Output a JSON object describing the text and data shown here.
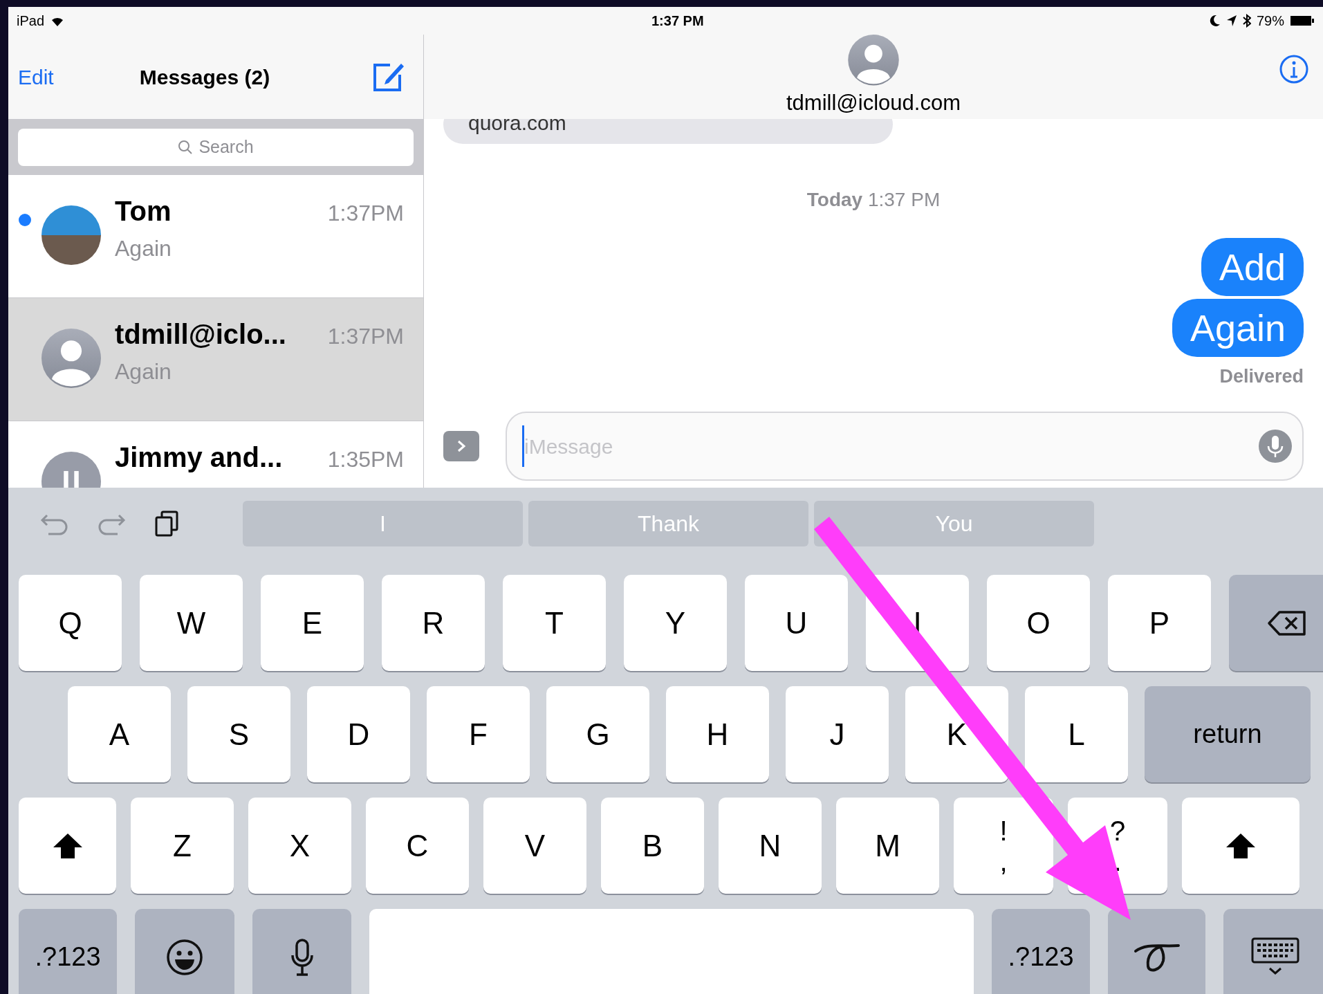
{
  "status_bar": {
    "device": "iPad",
    "time": "1:37 PM",
    "battery": "79%"
  },
  "sidebar": {
    "edit": "Edit",
    "title": "Messages (2)",
    "search": {
      "placeholder": "Search"
    },
    "conversations": [
      {
        "name": "Tom",
        "preview": "Again",
        "time": "1:37PM",
        "unread": true,
        "selected": false,
        "kind": "photo"
      },
      {
        "name": "tdmill@iclo...",
        "preview": "Again",
        "time": "1:37PM",
        "unread": false,
        "selected": true,
        "kind": "person"
      },
      {
        "name": "Jimmy and...",
        "time": "1:35PM",
        "unread": false,
        "selected": false,
        "kind": "group"
      }
    ]
  },
  "chat": {
    "contact": "tdmill@icloud.com",
    "messages": [
      {
        "kind": "received",
        "text": "quora.com"
      },
      {
        "kind": "timestamp",
        "text": "**Today** 1:37 PM"
      },
      {
        "kind": "sent",
        "text": "Add"
      },
      {
        "kind": "sent",
        "text": "Again"
      },
      {
        "kind": "status",
        "text": "Delivered"
      }
    ],
    "input": {
      "placeholder": "iMessage"
    }
  },
  "keyboard": {
    "suggestions": [
      "I",
      "Thank",
      "You"
    ],
    "rows": [
      {
        "keys": [
          {
            "kind": "letter",
            "label": "Q"
          },
          {
            "kind": "letter",
            "label": "W"
          },
          {
            "kind": "letter",
            "label": "E"
          },
          {
            "kind": "letter",
            "label": "R"
          },
          {
            "kind": "letter",
            "label": "T"
          },
          {
            "kind": "letter",
            "label": "Y"
          },
          {
            "kind": "letter",
            "label": "U"
          },
          {
            "kind": "letter",
            "label": "I"
          },
          {
            "kind": "letter",
            "label": "O"
          },
          {
            "kind": "letter",
            "label": "P"
          },
          {
            "kind": "delete"
          }
        ]
      },
      {
        "keys": [
          {
            "kind": "letter",
            "label": "A"
          },
          {
            "kind": "letter",
            "label": "S"
          },
          {
            "kind": "letter",
            "label": "D"
          },
          {
            "kind": "letter",
            "label": "F"
          },
          {
            "kind": "letter",
            "label": "G"
          },
          {
            "kind": "letter",
            "label": "H"
          },
          {
            "kind": "letter",
            "label": "J"
          },
          {
            "kind": "letter",
            "label": "K"
          },
          {
            "kind": "letter",
            "label": "L"
          },
          {
            "kind": "return",
            "label": "return"
          }
        ]
      },
      {
        "keys": [
          {
            "kind": "shift"
          },
          {
            "kind": "letter",
            "label": "Z"
          },
          {
            "kind": "letter",
            "label": "X"
          },
          {
            "kind": "letter",
            "label": "C"
          },
          {
            "kind": "letter",
            "label": "V"
          },
          {
            "kind": "letter",
            "label": "B"
          },
          {
            "kind": "letter",
            "label": "N"
          },
          {
            "kind": "letter",
            "label": "M"
          },
          {
            "kind": "punct",
            "label": "!",
            "sub": ","
          },
          {
            "kind": "punct",
            "label": "?",
            "sub": "."
          },
          {
            "kind": "shift"
          }
        ]
      },
      {
        "keys": [
          {
            "kind": "numbers",
            "label": ".?123"
          },
          {
            "kind": "emoji"
          },
          {
            "kind": "dictation"
          },
          {
            "kind": "space"
          },
          {
            "kind": "numbers",
            "label": ".?123"
          },
          {
            "kind": "handwriting"
          },
          {
            "kind": "dismiss"
          }
        ]
      }
    ]
  }
}
